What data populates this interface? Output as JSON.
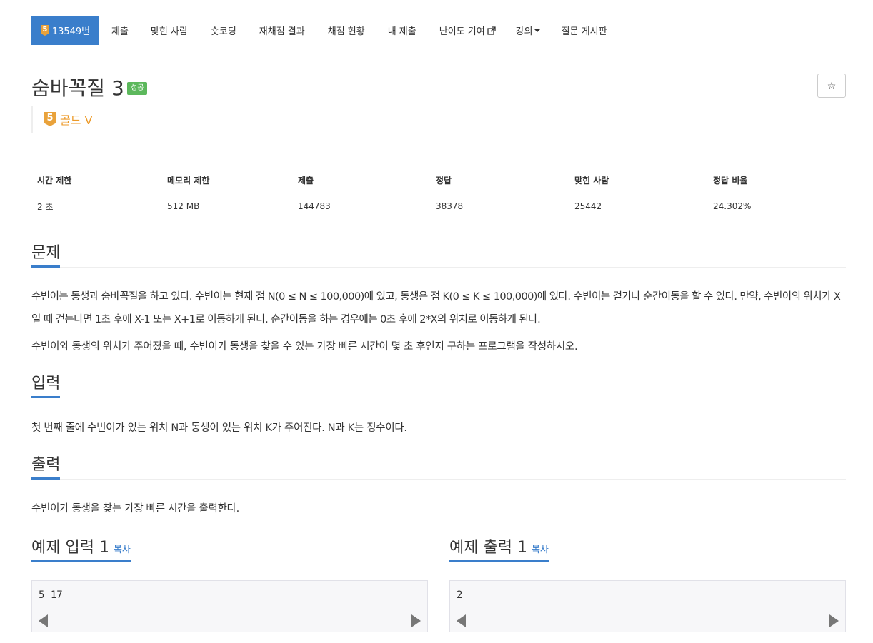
{
  "nav": {
    "active": {
      "icon": "tier-5-badge",
      "badge_text": "5",
      "label": "13549번"
    },
    "items": [
      "제출",
      "맞힌 사람",
      "숏코딩",
      "재채점 결과",
      "채점 현황",
      "내 제출",
      "난이도 기여",
      "강의",
      "질문 게시판"
    ]
  },
  "problem": {
    "title": "숨바꼭질 3",
    "result_label": "성공",
    "star_icon": "star-outline-icon",
    "tier_badge_text": "5",
    "tier_label": "골드 V",
    "tier_color": "#ec9a29"
  },
  "info": {
    "headers": [
      "시간 제한",
      "메모리 제한",
      "제출",
      "정답",
      "맞힌 사람",
      "정답 비율"
    ],
    "values": [
      "2 초",
      "512 MB",
      "144783",
      "38378",
      "25442",
      "24.302%"
    ]
  },
  "sections": {
    "problem": {
      "heading": "문제",
      "p1": "수빈이는 동생과 숨바꼭질을 하고 있다. 수빈이는 현재 점 N(0 ≤ N ≤ 100,000)에 있고, 동생은 점 K(0 ≤ K ≤ 100,000)에 있다. 수빈이는 걷거나 순간이동을 할 수 있다. 만약, 수빈이의 위치가 X일 때 걷는다면 1초 후에 X-1 또는 X+1로 이동하게 된다. 순간이동을 하는 경우에는 0초 후에 2*X의 위치로 이동하게 된다.",
      "p2": "수빈이와 동생의 위치가 주어졌을 때, 수빈이가 동생을 찾을 수 있는 가장 빠른 시간이 몇 초 후인지 구하는 프로그램을 작성하시오."
    },
    "input": {
      "heading": "입력",
      "text": "첫 번째 줄에 수빈이가 있는 위치 N과 동생이 있는 위치 K가 주어진다. N과 K는 정수이다."
    },
    "output": {
      "heading": "출력",
      "text": "수빈이가 동생을 찾는 가장 빠른 시간을 출력한다."
    },
    "sample_input": {
      "heading": "예제 입력 1",
      "copy": "복사",
      "content": "5 17"
    },
    "sample_output": {
      "heading": "예제 출력 1",
      "copy": "복사",
      "content": "2"
    }
  },
  "colors": {
    "accent": "#3a7ecb",
    "success": "#5cb85c",
    "gold": "#ec9a29"
  }
}
